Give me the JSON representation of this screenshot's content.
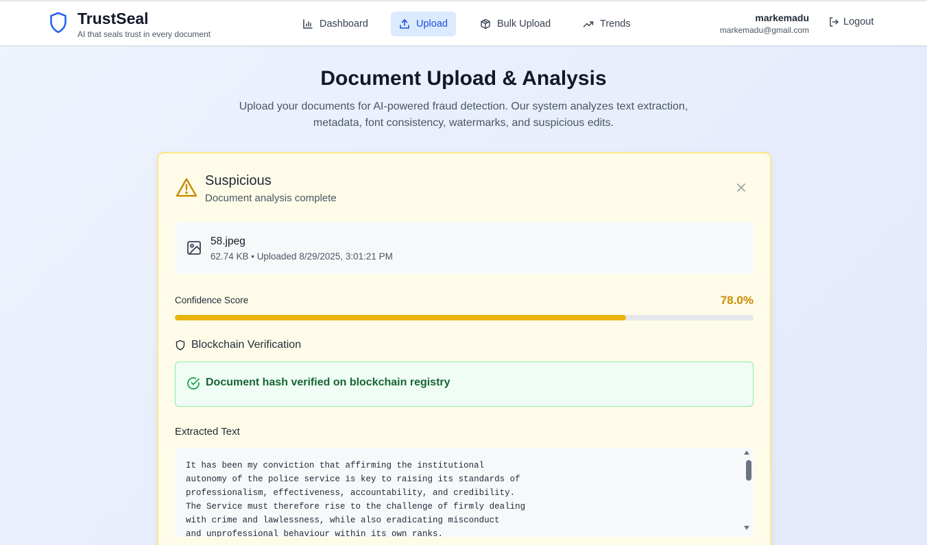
{
  "brand": {
    "name": "TrustSeal",
    "tagline": "AI that seals trust in every document",
    "icon": "shield-icon"
  },
  "nav": [
    {
      "label": "Dashboard",
      "icon": "bar-chart-icon",
      "active": false
    },
    {
      "label": "Upload",
      "icon": "upload-icon",
      "active": true
    },
    {
      "label": "Bulk Upload",
      "icon": "package-icon",
      "active": false
    },
    {
      "label": "Trends",
      "icon": "trending-up-icon",
      "active": false
    }
  ],
  "user": {
    "name": "markemadu",
    "email": "markemadu@gmail.com",
    "logout_label": "Logout"
  },
  "page": {
    "title": "Document Upload & Analysis",
    "subtitle": "Upload your documents for AI-powered fraud detection. Our system analyzes text extraction, metadata, font consistency, watermarks, and suspicious edits."
  },
  "result": {
    "status": "Suspicious",
    "status_sub": "Document analysis complete",
    "file": {
      "name": "58.jpeg",
      "meta": "62.74 KB • Uploaded 8/29/2025, 3:01:21 PM"
    },
    "confidence": {
      "label": "Confidence Score",
      "value_text": "78.0%",
      "value": 0.78
    },
    "blockchain": {
      "heading": "Blockchain Verification",
      "message": "Document hash verified on blockchain registry"
    },
    "extracted": {
      "heading": "Extracted Text",
      "text": "It has been my conviction that affirming the institutional\nautonomy of the police service is key to raising its standards of\nprofessionalism, effectiveness, accountability, and credibility.\nThe Service must therefore rise to the challenge of firmly dealing\nwith crime and lawlessness, while also eradicating misconduct\nand unprofessional behaviour within its own ranks."
    }
  },
  "colors": {
    "accent": "#1d4ed8",
    "warning": "#ca8a04",
    "progress": "#eab308",
    "success": "#166534",
    "card_bg": "#fefce8"
  }
}
